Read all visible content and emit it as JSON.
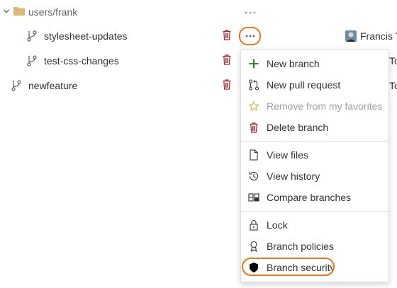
{
  "tree": {
    "folder": {
      "label": "users/frank"
    },
    "rows": [
      {
        "label": "stylesheet-updates",
        "author": "Francis To"
      },
      {
        "label": "test-css-changes",
        "author": "To"
      },
      {
        "label": "newfeature",
        "author": "To"
      }
    ]
  },
  "menu": {
    "items": [
      {
        "label": "New branch",
        "icon": "plus-icon"
      },
      {
        "label": "New pull request",
        "icon": "pull-request-icon"
      },
      {
        "label": "Remove from my favorites",
        "icon": "star-icon",
        "disabled": true
      },
      {
        "label": "Delete branch",
        "icon": "trash-icon"
      },
      {
        "label": "View files",
        "icon": "file-icon"
      },
      {
        "label": "View history",
        "icon": "history-icon"
      },
      {
        "label": "Compare branches",
        "icon": "compare-icon"
      },
      {
        "label": "Lock",
        "icon": "lock-icon"
      },
      {
        "label": "Branch policies",
        "icon": "policy-ribbon-icon"
      },
      {
        "label": "Branch security",
        "icon": "shield-icon"
      }
    ]
  },
  "colors": {
    "accent_green": "#107c10",
    "delete_red": "#a4262c",
    "highlight_orange": "#e8771a",
    "folder_tan": "#dcb67a"
  }
}
